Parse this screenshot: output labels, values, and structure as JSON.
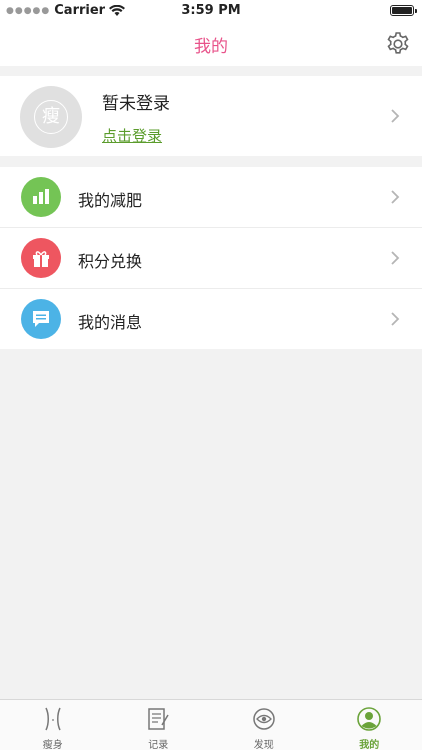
{
  "status_bar": {
    "carrier": "Carrier",
    "time": "3:59 PM",
    "battery_level": 1.0
  },
  "nav": {
    "title": "我的"
  },
  "profile": {
    "avatar_glyph": "瘦",
    "name": "暂未登录",
    "login_link": "点击登录"
  },
  "menu": [
    {
      "label": "我的减肥",
      "icon": "bar-chart-icon",
      "color": "#74c455"
    },
    {
      "label": "积分兑换",
      "icon": "gift-icon",
      "color": "#ee5660"
    },
    {
      "label": "我的消息",
      "icon": "message-icon",
      "color": "#4cb3e6"
    }
  ],
  "tabs": [
    {
      "label": "瘦身",
      "icon": "waist-icon",
      "active": false
    },
    {
      "label": "记录",
      "icon": "notepad-icon",
      "active": false
    },
    {
      "label": "发现",
      "icon": "eye-icon",
      "active": false
    },
    {
      "label": "我的",
      "icon": "user-icon",
      "active": true
    }
  ],
  "colors": {
    "title": "#e8538a",
    "link": "#5b9c2c",
    "tab_active": "#6aa33a",
    "background": "#f2f2f2"
  }
}
